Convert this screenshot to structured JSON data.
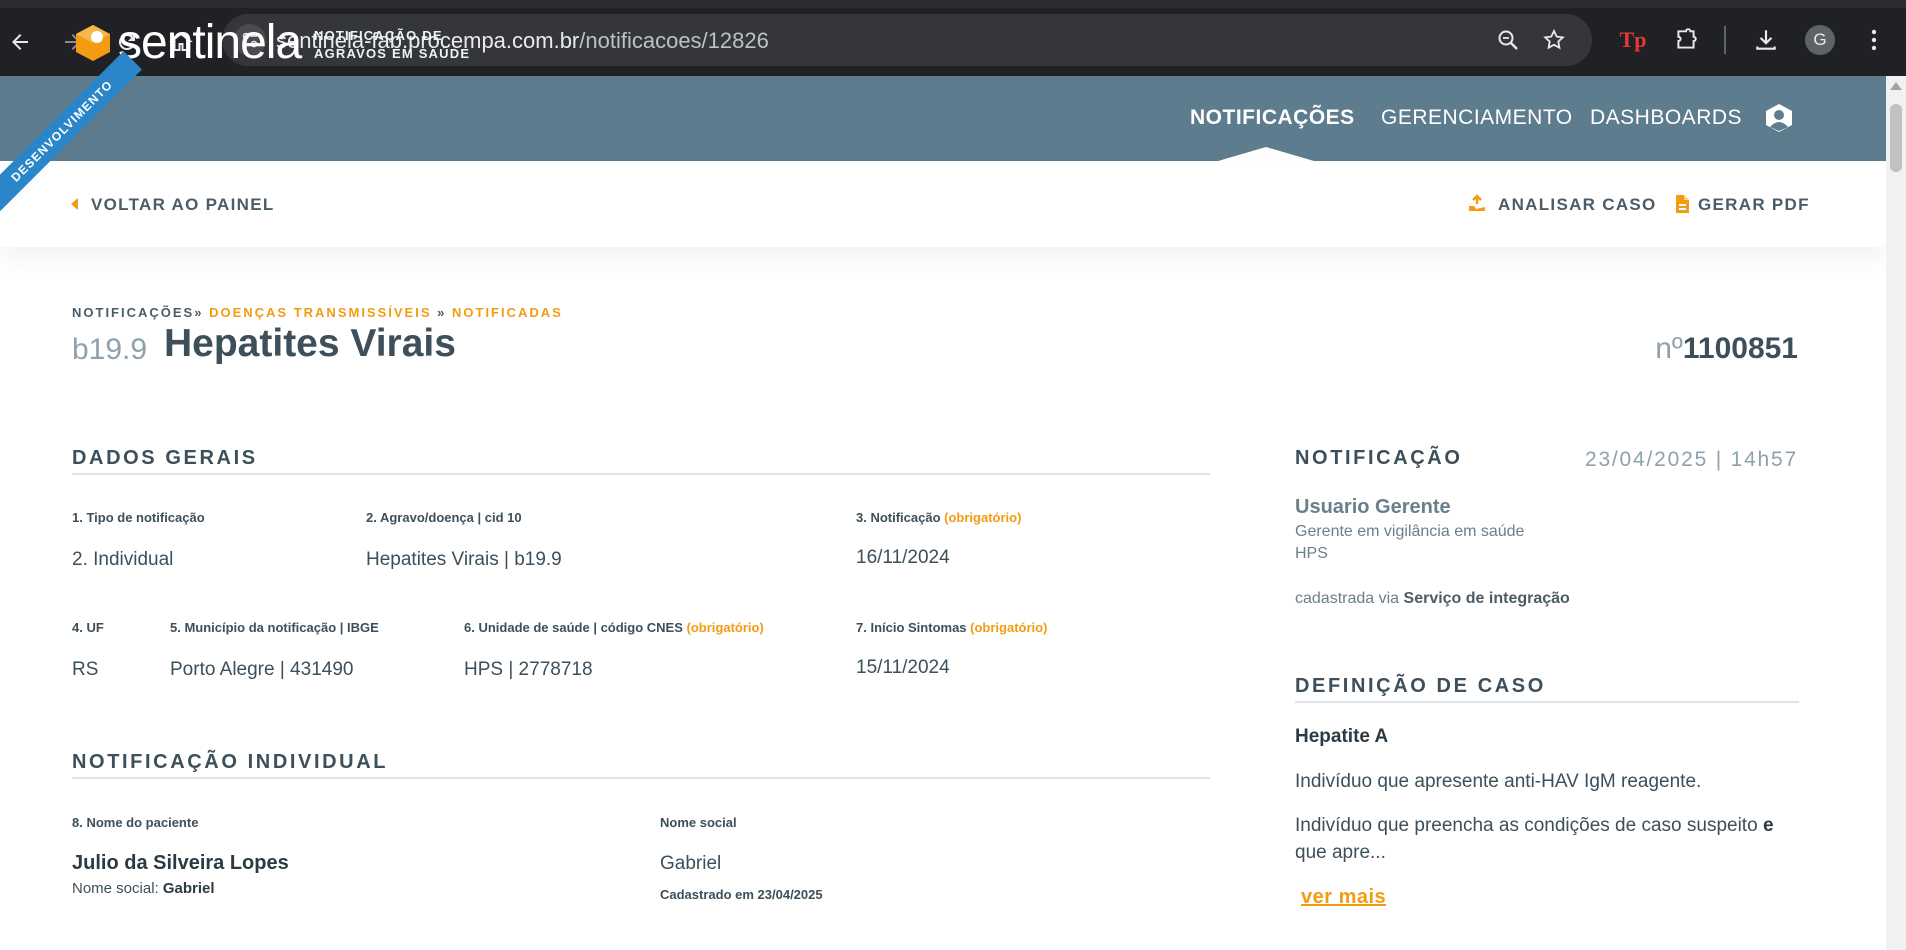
{
  "browser": {
    "url_host": "sentinela-fab.procempa.com.br",
    "url_path": "/notificacoes/12826",
    "profile_initial": "G",
    "extension_label": "Tp"
  },
  "header": {
    "ribbon": "DESENVOLVIMENTO",
    "logo": "sentinela",
    "logo_sub_1": "NOTIFICAÇÃO DE",
    "logo_sub_2": "AGRAVOS EM SAÚDE",
    "nav": {
      "notificacoes": "NOTIFICAÇÕES",
      "gerenciamento": "GERENCIAMENTO",
      "dashboards": "DASHBOARDS"
    }
  },
  "actions": {
    "back": "VOLTAR AO PAINEL",
    "analisar": "ANALISAR CASO",
    "gerar_pdf": "GERAR PDF"
  },
  "breadcrumb": {
    "root": "NOTIFICAÇÕES»",
    "middle": "DOENÇAS TRANSMISSÍVEIS",
    "sep": "»",
    "last": "NOTIFICADAS"
  },
  "title": {
    "cid": "b19.9",
    "name": "Hepatites Virais",
    "number_prefix": "nº",
    "number": "1100851"
  },
  "dados_gerais": {
    "heading": "DADOS GERAIS",
    "f1_label": "1. Tipo de notificação",
    "f1_value": "2. Individual",
    "f2_label": "2. Agravo/doença | cid 10",
    "f2_value": "Hepatites Virais | b19.9",
    "f3_label": "3. Notificação",
    "f3_req": "(obrigatório)",
    "f3_value": "16/11/2024",
    "f4_label": "4. UF",
    "f4_value": "RS",
    "f5_label": "5. Município da notificação | IBGE",
    "f5_value": "Porto Alegre | 431490",
    "f6_label": "6. Unidade de saúde | código CNES",
    "f6_req": "(obrigatório)",
    "f6_value": "HPS | 2778718",
    "f7_label": "7. Início Sintomas",
    "f7_req": "(obrigatório)",
    "f7_value": "15/11/2024"
  },
  "notificacao_individual": {
    "heading": "NOTIFICAÇÃO INDIVIDUAL",
    "f8_label": "8. Nome do paciente",
    "f8_value": "Julio da Silveira Lopes",
    "social_prefix": "Nome social:",
    "social_inline": "Gabriel",
    "social_label": "Nome social",
    "social_value": "Gabriel",
    "registered": "Cadastrado em 23/04/2025"
  },
  "notificacao": {
    "heading": "NOTIFICAÇÃO",
    "date": "23/04/2025 | 14h57",
    "user": "Usuario Gerente",
    "role": "Gerente em vigilância em saúde",
    "unit": "HPS",
    "via_prefix": "cadastrada via",
    "via": "Serviço de integração"
  },
  "definicao": {
    "heading": "DEFINIÇÃO DE CASO",
    "subtitle": "Hepatite A",
    "p1": "Indivíduo que apresente anti-HAV IgM reagente.",
    "p2_a": "Indivíduo que preencha as condições de caso suspeito",
    "p2_b": "e",
    "p2_c": "que apre...",
    "more": "ver mais"
  }
}
